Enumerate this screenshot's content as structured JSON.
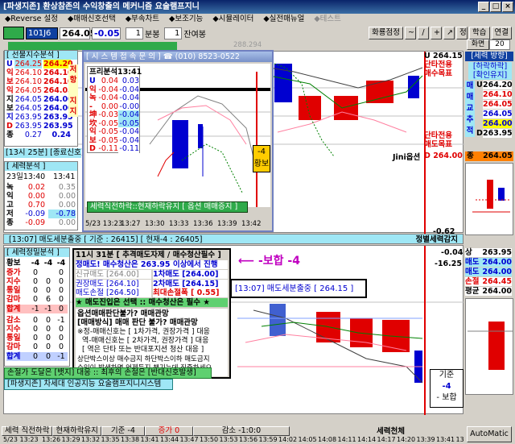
{
  "window": {
    "title": "[파생지존] 환상참존의 수익창출의 메커니즘 요술램프지니",
    "buttons": [
      "_",
      "□",
      "×"
    ]
  },
  "menu": [
    "◆Reverse 설정",
    "◆매매신호선택",
    "◆부속차트",
    "◆보조기능",
    "◆시뮬레이터",
    "◆실전매뉴얼",
    "◆테스트"
  ],
  "toolbar": {
    "code": "101J6",
    "price": "264.05",
    "change": "-0.05",
    "interval_value": "1",
    "interval_label": "분봉",
    "count_value": "1",
    "count_label": "잔여봉",
    "right_buttons": [
      "화룡점정",
      "~",
      "/",
      "+",
      "↗",
      "정",
      "학습",
      "연결"
    ],
    "screen_label": "화면",
    "screen_value": "20",
    "ghost_value": "288.294"
  },
  "futures_panel": {
    "title": "[ 선물지수분석 ]",
    "rows": [
      {
        "label": "U",
        "a": "264.25",
        "b": "264.20"
      },
      {
        "label": "익",
        "a": "264.10",
        "b": "264.10"
      },
      {
        "label": "보",
        "a": "264.10",
        "b": "264.10"
      },
      {
        "label": "익",
        "a": "264.05",
        "b": "264.05"
      },
      {
        "label": "지",
        "a": "264.05",
        "b": "264.00"
      },
      {
        "label": "보",
        "a": "264.05",
        "b": "264.00"
      },
      {
        "label": "지",
        "a": "263.95",
        "b": "263.95"
      },
      {
        "label": "D",
        "a": "263.95",
        "b": "263.95"
      },
      {
        "label": "종",
        "a": "0.27",
        "b": "0.24"
      }
    ],
    "side": [
      "저",
      "항",
      "지",
      "지"
    ],
    "footer": "[13시 25분] [종료신호]"
  },
  "force_panel": {
    "title": "[ 세력분석 ]",
    "time_a": "23일13:40",
    "time_b": "13:41",
    "rows": [
      {
        "label": "녹",
        "a": "0.02",
        "b": "0.35"
      },
      {
        "label": "익",
        "a": "0.00",
        "b": "0.00"
      },
      {
        "label": "고",
        "a": "0.70",
        "b": "0.00"
      },
      {
        "label": "저",
        "a": "-0.09",
        "b": "-0.78"
      },
      {
        "label": "종",
        "a": "-0.09",
        "b": "0.00"
      }
    ]
  },
  "dialog": {
    "title": "[ 시 스 템  접 속 문 의 ]   ☎ (010) 8523-0522",
    "sub_title": "프리분석13:41",
    "rows": [
      {
        "label": "U",
        "v": "0.04",
        "w": "0.03"
      },
      {
        "label": "익",
        "v": "-0.04",
        "w": "-0.04"
      },
      {
        "label": "녹",
        "v": "-0.04",
        "w": "-0.04"
      },
      {
        "label": "-",
        "v": "0.00",
        "w": "-0.00"
      },
      {
        "label": "坤",
        "v": "-0.03",
        "w": "-0.04"
      },
      {
        "label": "坎",
        "v": "-0.05",
        "w": "-0.05"
      },
      {
        "label": "익",
        "v": "-0.05",
        "w": "-0.04"
      },
      {
        "label": "보",
        "v": "-0.05",
        "w": "-0.04"
      },
      {
        "label": "D",
        "v": "-0.11",
        "w": "-0.11"
      }
    ],
    "status": "세력직전하락::현재하락유지 [ 옵션 매매증지 ]",
    "box_value": "-4",
    "box_label": "황보",
    "x_ticks": [
      "5/23 13:23",
      "13:27",
      "13:30",
      "13:33",
      "13:36",
      "13:39",
      "13:42"
    ]
  },
  "right_panel": {
    "u_value": "U 264.15",
    "u_label1": "단타전용",
    "u_label2": "매수목표",
    "d_label1": "단타전용",
    "d_label2": "매도목표",
    "d_value": "D 264.00",
    "jini_label": "Jini옵션",
    "neg_value": "-0.62",
    "force_dir_title": "[세력 방향]",
    "force_dir_sub": "[하락하락]",
    "force_dir_sub2": "[확인유지]",
    "vertical_label": [
      "매",
      "매",
      "교",
      "추",
      "적"
    ],
    "levels": [
      {
        "label": "U",
        "v": "264.20"
      },
      {
        "label": "",
        "v": "264.10"
      },
      {
        "label": "",
        "v": "264.05"
      },
      {
        "label": "",
        "v": "264.05"
      },
      {
        "label": "",
        "v": "264.00"
      },
      {
        "label": "D",
        "v": "263.95"
      }
    ],
    "bottom_value": "264.05",
    "bottom_label": "종"
  },
  "mid_status": {
    "left": "[13:07] 매도세분출중 [ 기준 : 26415] [ 현재-4 : 26405]",
    "right": "정별세력감지"
  },
  "force_judge": {
    "title": "[ 세력정밀분석 ]",
    "head": [
      "황보",
      "-4",
      "-4",
      "-4"
    ],
    "rows_top": [
      {
        "label": "증가",
        "a": "0",
        "b": "",
        "c": "0"
      },
      {
        "label": "지수",
        "a": "0",
        "b": "0",
        "c": "0"
      },
      {
        "label": "통일",
        "a": "0",
        "b": "0",
        "c": "0"
      },
      {
        "label": "감마",
        "a": "0",
        "b": "6",
        "c": "0"
      }
    ],
    "sum1_label": "합계",
    "sum1": [
      "-1",
      "-1",
      "0"
    ],
    "rows_bottom": [
      {
        "label": "감소",
        "a": "0",
        "b": "0",
        "c": "-1"
      },
      {
        "label": "지수",
        "a": "0",
        "b": "0",
        "c": "0"
      },
      {
        "label": "통일",
        "a": "0",
        "b": "0",
        "c": "0"
      },
      {
        "label": "감마",
        "a": "0",
        "b": "0",
        "c": "0"
      }
    ],
    "sum2_label": "합계",
    "sum2": [
      "0",
      "0",
      "-1"
    ]
  },
  "info": {
    "header": "11시 31분 [ 추격매도자제 / 매수청산필수 ]",
    "line1": "정매도! 매수청산은 263.95 이상에서 진행",
    "grid": [
      {
        "a": "신규매도 [264.00]",
        "b": "1차매도 [264.00]"
      },
      {
        "a": "권장매도 [264.10]",
        "b": "2차매도 [264.15]"
      },
      {
        "a": "매도손절 [264.50]",
        "b": "최대손절폭 [ 0.55]"
      }
    ],
    "note": "★ 매도진입은 선택  ::  매수청산은 필수 ★",
    "q1": "옵션매매판단불가? 매매관망",
    "q2": "[매매방식] 매매 판단 불가? 매매관망",
    "q3": "※정-매매신호는 [ 1차가격, 권장가격 ] 대응",
    "q4": "역-매매신호는 [ 2차가격, 권장가격 ] 대응",
    "q5": "[ 역은 단타 또는  반대포지션 청산 대응 ]",
    "q6": "상단박스이상 매수금지   하단박스이하 매도금지",
    "q7": "수익이 발생하면 언제든지 챙기는데 집중하세요"
  },
  "bohap": "-보합 -4",
  "sell_box": "[13:07] 매도세분출중 [ 264.15 ]",
  "right_lower": {
    "top1": "-0.04",
    "top2": "-16.25",
    "rows": [
      {
        "label": "상",
        "v": "263.95"
      },
      {
        "label": "매도",
        "v": "264.00"
      },
      {
        "label": "매도",
        "v": "264.00"
      },
      {
        "label": "손절",
        "v": "264.45"
      },
      {
        "label": "평균",
        "v": "264.00"
      }
    ],
    "gijun": "기준",
    "gijun_v": "-4",
    "gijun_sub": "- 보합"
  },
  "bottom_bar1": "손절가 도달은 [뱃지] 대응 :: 최후의 손절은 [반대신호발생]",
  "bottom_bar2": "[파생지존] 차세대 인공지능 요술램프지니시스템",
  "status": {
    "segments": [
      "세력 직전하락",
      "현재하락유지",
      "기준 -4",
      "증가 0",
      "감소 -1:0:0"
    ],
    "right_label": "세력천체",
    "x_ticks": [
      "5/23 13:23",
      "13:26",
      "13:29",
      "13:32",
      "13:35",
      "13:38",
      "13:41",
      "13:44",
      "13:47",
      "13:50",
      "13:53",
      "13:56",
      "13:59",
      "14:02",
      "14:05",
      "14:08",
      "14:11",
      "14:14",
      "14:17",
      "14:20",
      "13:39",
      "13:41",
      "13:42"
    ],
    "auto_button": "AutoMatic"
  },
  "colors": {
    "bull": "#e00000",
    "bear": "#0000d0",
    "cyan": "#9fe7f5",
    "green": "#2faa4a",
    "yellow": "#ffff00"
  }
}
